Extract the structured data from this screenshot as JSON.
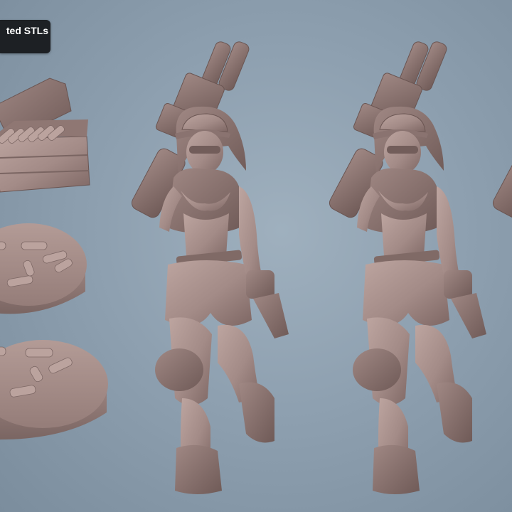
{
  "badge": {
    "text": "ted STLs"
  },
  "colors": {
    "background": "#8ea0b0",
    "model": "#a38b87",
    "model_shadow": "#7e6764",
    "model_highlight": "#bda5a0",
    "badge_bg": "#1d2024",
    "badge_text": "#ffffff"
  },
  "models": [
    {
      "name": "ammo-crate-icon"
    },
    {
      "name": "shell-base-icon"
    },
    {
      "name": "shell-base-icon"
    },
    {
      "name": "figure-icon"
    },
    {
      "name": "figure-icon"
    },
    {
      "name": "figure-icon"
    }
  ]
}
